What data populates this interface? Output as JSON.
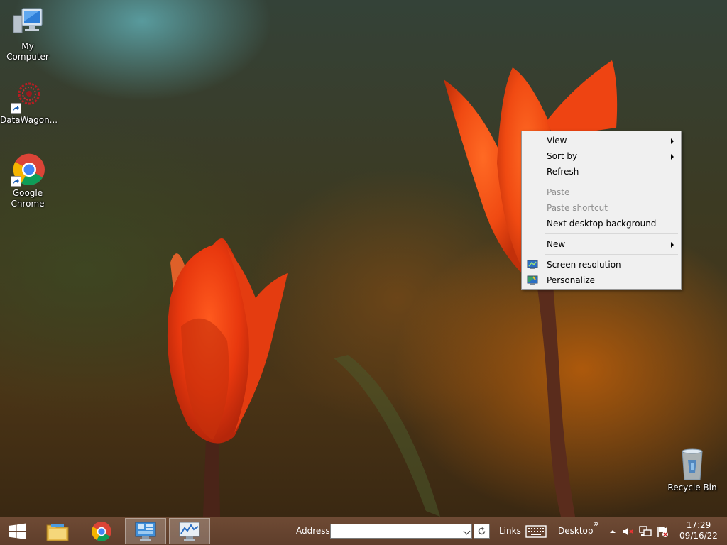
{
  "desktop": {
    "icons": [
      {
        "label": "My Computer",
        "icon": "computer-icon"
      },
      {
        "label": "DataWagon...",
        "icon": "datawagon-icon"
      },
      {
        "label": "Google\nChrome",
        "icon": "chrome-icon"
      },
      {
        "label": "Recycle Bin",
        "icon": "recycle-bin-icon"
      }
    ]
  },
  "context_menu": {
    "items": [
      {
        "label": "View",
        "submenu": true,
        "disabled": false
      },
      {
        "label": "Sort by",
        "submenu": true,
        "disabled": false
      },
      {
        "label": "Refresh",
        "submenu": false,
        "disabled": false
      },
      {
        "label": "Paste",
        "submenu": false,
        "disabled": true
      },
      {
        "label": "Paste shortcut",
        "submenu": false,
        "disabled": true
      },
      {
        "label": "Next desktop background",
        "submenu": false,
        "disabled": false
      },
      {
        "label": "New",
        "submenu": true,
        "disabled": false
      },
      {
        "label": "Screen resolution",
        "icon": "screen-resolution-icon",
        "disabled": false
      },
      {
        "label": "Personalize",
        "icon": "personalize-icon",
        "disabled": false
      }
    ]
  },
  "taskbar": {
    "pinned": [
      {
        "name": "start-button",
        "icon": "windows-logo-icon"
      },
      {
        "name": "file-explorer",
        "icon": "folder-icon"
      },
      {
        "name": "chrome",
        "icon": "chrome-icon"
      },
      {
        "name": "control-panel",
        "icon": "control-panel-icon",
        "active": true
      },
      {
        "name": "task-manager",
        "icon": "performance-monitor-icon",
        "active": true
      }
    ],
    "address_label": "Address",
    "address_value": "",
    "links_label": "Links",
    "desktop_label": "Desktop",
    "overflow_label": "»",
    "tray": [
      "show-hidden-icon",
      "volume-muted-icon",
      "network-icon",
      "action-center-flag-icon"
    ],
    "clock": {
      "time": "17:29",
      "date": "09/16/22"
    }
  },
  "colors": {
    "taskbar": "#5f3e2b",
    "menu_bg": "#f0f0f0",
    "menu_border": "#979797",
    "disabled_text": "#8e8e8e"
  }
}
